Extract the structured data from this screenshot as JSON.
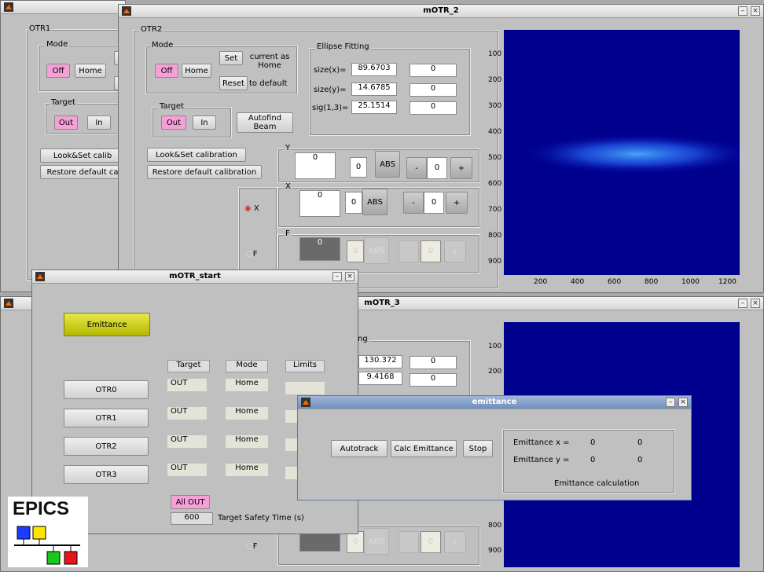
{
  "win_otr1": {
    "panel_label": "OTR1",
    "mode_label": "Mode",
    "off": "Off",
    "home": "Home",
    "target_label": "Target",
    "out": "Out",
    "in": "In",
    "look_set": "Look&Set calib",
    "restore": "Restore default ca"
  },
  "win_otr2": {
    "title": "mOTR_2",
    "panel_label": "OTR2",
    "mode_label": "Mode",
    "off": "Off",
    "home": "Home",
    "set": "Set",
    "set_desc": "current as Home",
    "reset": "Reset",
    "reset_desc": "to default",
    "target_label": "Target",
    "out": "Out",
    "in": "In",
    "autofind": "Autofind Beam",
    "look_set": "Look&Set calibration",
    "restore": "Restore default calibration",
    "ellipse": {
      "label": "Ellipse Fitting",
      "rows": [
        {
          "label": "size(x)=",
          "value": "89.6703",
          "extra": "0"
        },
        {
          "label": "size(y)=",
          "value": "14.6785",
          "extra": "0"
        },
        {
          "label": "sig(1,3)=",
          "value": "25.1514",
          "extra": "0"
        }
      ]
    },
    "y_group": {
      "label": "Y",
      "value": "0",
      "field": "0",
      "abs": "ABS",
      "minus": "-",
      "step": "0",
      "plus": "+"
    },
    "x_group": {
      "label": "X",
      "value": "0",
      "field": "0",
      "abs": "ABS",
      "minus": "-",
      "step": "0",
      "plus": "+"
    },
    "f_group": {
      "label": "F",
      "value": "0",
      "field": "0",
      "abs": "ABS",
      "minus": "-",
      "step": "0",
      "plus": "+"
    },
    "radio_x": "X",
    "radio_f": "F",
    "plot": {
      "yticks": [
        "100",
        "200",
        "300",
        "400",
        "500",
        "600",
        "700",
        "800",
        "900"
      ],
      "xticks": [
        "200",
        "400",
        "600",
        "800",
        "1000",
        "1200"
      ]
    }
  },
  "win_start": {
    "title": "mOTR_start",
    "emittance_btn": "Emittance",
    "headers": [
      "Target",
      "Mode",
      "Limits"
    ],
    "rows": [
      {
        "name": "OTR0",
        "target": "OUT",
        "mode": "Home"
      },
      {
        "name": "OTR1",
        "target": "OUT",
        "mode": "Home"
      },
      {
        "name": "OTR2",
        "target": "OUT",
        "mode": "Home"
      },
      {
        "name": "OTR3",
        "target": "OUT",
        "mode": "Home"
      }
    ],
    "all_out": "All OUT",
    "safety_value": "600",
    "safety_label": "Target Safety Time (s)",
    "logo_text": "EPICS"
  },
  "win_otr3": {
    "title": "mOTR_3",
    "ellipse_label": "ng",
    "values": [
      "130.372",
      "9.4168"
    ],
    "extras": [
      "0",
      "0"
    ],
    "radio_f": "F",
    "f_group": {
      "field": "0",
      "abs": "ABS",
      "minus": "-",
      "step": "0",
      "plus": "+"
    },
    "plot": {
      "yticks": [
        "100",
        "200",
        "700",
        "800",
        "900"
      ]
    }
  },
  "win_emit": {
    "title": "emittance",
    "autotrack": "Autotrack",
    "calc": "Calc Emittance",
    "stop": "Stop",
    "ex_label": "Emittance x =",
    "ex_v1": "0",
    "ex_v2": "0",
    "ey_label": "Emittance y =",
    "ey_v1": "0",
    "ey_v2": "0",
    "group_label": "Emittance calculation"
  },
  "colors": {
    "plot_bg": "#00008f",
    "pink": "#f5a0d6",
    "yellow": "#cfd100"
  }
}
